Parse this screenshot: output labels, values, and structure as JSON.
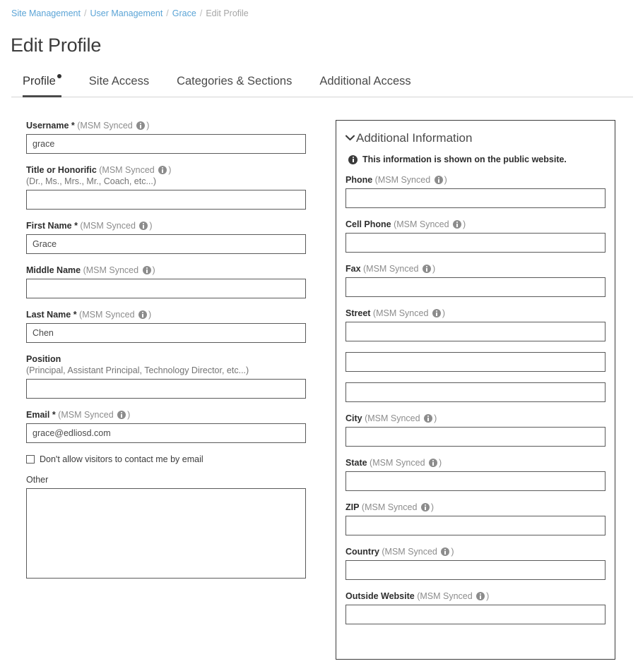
{
  "breadcrumb": {
    "items": [
      {
        "label": "Site Management",
        "current": false
      },
      {
        "label": "User Management",
        "current": false
      },
      {
        "label": "Grace",
        "current": false
      },
      {
        "label": "Edit Profile",
        "current": true
      }
    ],
    "separator": "/"
  },
  "page": {
    "title": "Edit Profile"
  },
  "tabs": [
    {
      "label": "Profile",
      "active": true,
      "dot": true
    },
    {
      "label": "Site Access",
      "active": false,
      "dot": false
    },
    {
      "label": "Categories & Sections",
      "active": false,
      "dot": false
    },
    {
      "label": "Additional Access",
      "active": false,
      "dot": false
    }
  ],
  "synced_suffix": {
    "open": "(MSM Synced ",
    "close": ")"
  },
  "left_form": {
    "fields": [
      {
        "label": "Username",
        "required": true,
        "synced": true,
        "hint": "",
        "value": "grace",
        "placeholder": ""
      },
      {
        "label": "Title or Honorific",
        "required": false,
        "synced": true,
        "hint": "(Dr., Ms., Mrs., Mr., Coach, etc...)",
        "value": "",
        "placeholder": ""
      },
      {
        "label": "First Name",
        "required": true,
        "synced": true,
        "hint": "",
        "value": "Grace",
        "placeholder": ""
      },
      {
        "label": "Middle Name",
        "required": false,
        "synced": true,
        "hint": "",
        "value": "",
        "placeholder": ""
      },
      {
        "label": "Last Name",
        "required": true,
        "synced": true,
        "hint": "",
        "value": "Chen",
        "placeholder": ""
      },
      {
        "label": "Position",
        "required": false,
        "synced": false,
        "hint": "(Principal, Assistant Principal, Technology Director, etc...)",
        "value": "",
        "placeholder": ""
      },
      {
        "label": "Email",
        "required": true,
        "synced": true,
        "hint": "",
        "value": "grace@edliosd.com",
        "placeholder": ""
      }
    ],
    "checkbox": {
      "label": "Don't allow visitors to contact me by email",
      "checked": false
    },
    "other": {
      "label": "Other",
      "value": "",
      "placeholder": ""
    }
  },
  "right_panel": {
    "heading": "Additional Information",
    "chevron": "⌄",
    "note": "This information is shown on the public website.",
    "fields": [
      {
        "label": "Phone",
        "synced": true,
        "value": "",
        "extra_lines": 0
      },
      {
        "label": "Cell Phone",
        "synced": true,
        "value": "",
        "extra_lines": 0
      },
      {
        "label": "Fax",
        "synced": true,
        "value": "",
        "extra_lines": 0
      },
      {
        "label": "Street",
        "synced": true,
        "value": "",
        "extra_lines": 2
      },
      {
        "label": "City",
        "synced": true,
        "value": "",
        "extra_lines": 0
      },
      {
        "label": "State",
        "synced": true,
        "value": "",
        "extra_lines": 0
      },
      {
        "label": "ZIP",
        "synced": true,
        "value": "",
        "extra_lines": 0
      },
      {
        "label": "Country",
        "synced": true,
        "value": "",
        "extra_lines": 0
      },
      {
        "label": "Outside Website",
        "synced": true,
        "value": "",
        "extra_lines": 0
      }
    ]
  },
  "colors": {
    "link": "#5ba4d6",
    "muted": "#8c8c8c",
    "text": "#333333",
    "border": "#5a5a5a",
    "panel_border": "#3b3b3b"
  }
}
